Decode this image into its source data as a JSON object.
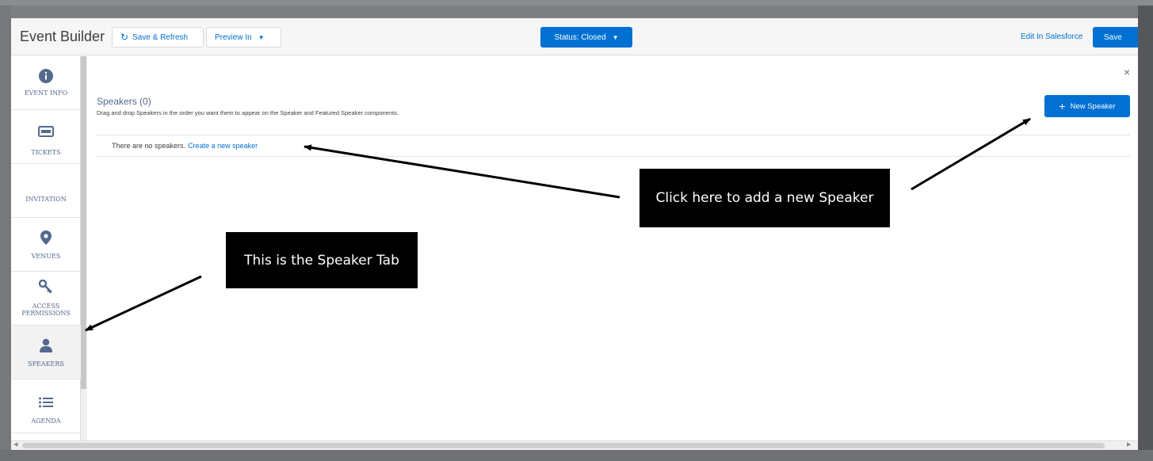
{
  "header": {
    "title": "Event Builder",
    "save_refresh_label": "Save & Refresh",
    "preview_label": "Preview In",
    "status_label": "Status: Closed",
    "edit_link_label": "Edit In Salesforce",
    "save_label": "Save"
  },
  "sidebar": {
    "items": [
      {
        "label": "EVENT INFO",
        "icon": "info-icon"
      },
      {
        "label": "TICKETS",
        "icon": "ticket-icon"
      },
      {
        "label": "INVITATION",
        "icon": ""
      },
      {
        "label": "VENUES",
        "icon": "location-pin-icon"
      },
      {
        "label": "ACCESS PERMISSIONS",
        "icon": "key-icon"
      },
      {
        "label": "SPEAKERS",
        "icon": "person-icon"
      },
      {
        "label": "AGENDA",
        "icon": "list-icon"
      }
    ],
    "active": "SPEAKERS"
  },
  "main": {
    "title": "Speakers (0)",
    "description": "Drag and drop Speakers in the order you want them to appear on the Speaker and Featured Speaker components.",
    "new_speaker_label": "New Speaker",
    "empty_text": "There are no speakers.",
    "empty_link": "Create a new speaker",
    "close_symbol": "×"
  },
  "annotations": {
    "callout_new_speaker": "Click here to add a new Speaker",
    "callout_speaker_tab": "This is the Speaker Tab"
  },
  "colors": {
    "brand_blue": "#0070d2",
    "callout_bg": "#000000",
    "backdrop": "#7d7f82"
  }
}
